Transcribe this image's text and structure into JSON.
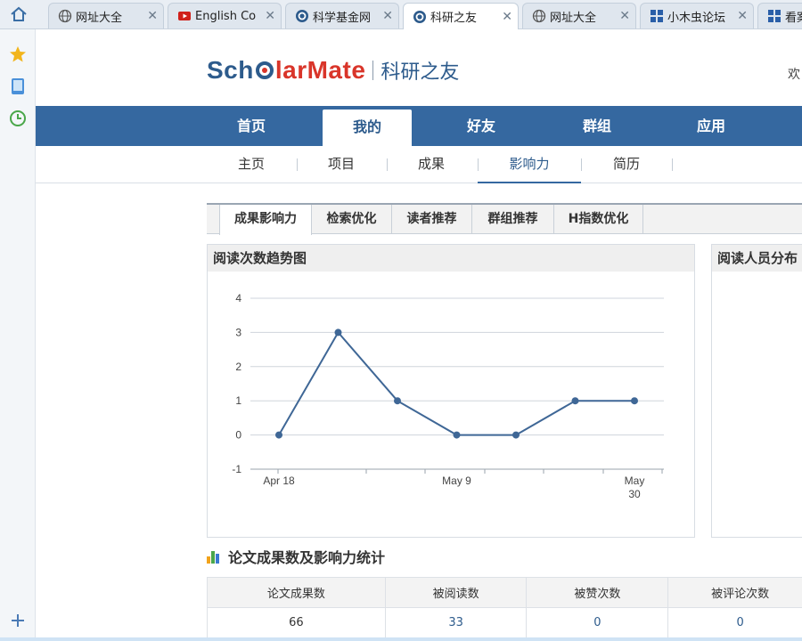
{
  "browser": {
    "tabs": [
      {
        "title": "网址大全",
        "icon": "globe-icon",
        "active": false
      },
      {
        "title": "English Co",
        "icon": "youtube-icon",
        "active": false
      },
      {
        "title": "科学基金网",
        "icon": "scholarmate-icon",
        "active": false
      },
      {
        "title": "科研之友",
        "icon": "scholarmate-icon",
        "active": true
      },
      {
        "title": "网址大全",
        "icon": "globe-icon",
        "active": false
      },
      {
        "title": "小木虫论坛",
        "icon": "grid-icon",
        "active": false
      },
      {
        "title": "看案",
        "icon": "grid-icon",
        "active": false
      }
    ],
    "sidebar_icons": [
      "star-icon",
      "tablet-icon",
      "clock-icon",
      "plus-icon"
    ]
  },
  "header": {
    "logo_part1": "Sch",
    "logo_part2": "larMate",
    "logo_cn": "科研之友",
    "welcome": "欢"
  },
  "main_nav": [
    "首页",
    "我的",
    "好友",
    "群组",
    "应用"
  ],
  "main_nav_active": "我的",
  "sub_nav": [
    "主页",
    "项目",
    "成果",
    "影响力",
    "简历"
  ],
  "sub_nav_active": "影响力",
  "inner_tabs": [
    "成果影响力",
    "检索优化",
    "读者推荐",
    "群组推荐",
    "H指数优化"
  ],
  "inner_tab_active": "成果影响力",
  "chart_panel": {
    "title": "阅读次数趋势图"
  },
  "dist_panel": {
    "title": "阅读人员分布"
  },
  "colors": {
    "nav_blue": "#3568a0",
    "logo_blue": "#2d5b8c",
    "logo_red": "#d9352a",
    "line": "#3f6796"
  },
  "chart_data": {
    "type": "line",
    "x_labels": [
      "Apr 18",
      "May 9",
      "May\n30"
    ],
    "x": [
      "Apr 18",
      "Apr 25",
      "May 2",
      "May 9",
      "May 16",
      "May 23",
      "May 30"
    ],
    "values": [
      0,
      3,
      1,
      0,
      0,
      1,
      1
    ],
    "y_ticks": [
      4,
      3,
      2,
      1,
      0,
      -1
    ],
    "ylim": [
      -1,
      4
    ],
    "grid": true,
    "legend": "none"
  },
  "stats": {
    "title": "论文成果数及影响力统计",
    "headers": [
      "论文成果数",
      "被阅读数",
      "被赞次数",
      "被评论次数"
    ],
    "row": [
      "66",
      "33",
      "0",
      "0"
    ]
  }
}
